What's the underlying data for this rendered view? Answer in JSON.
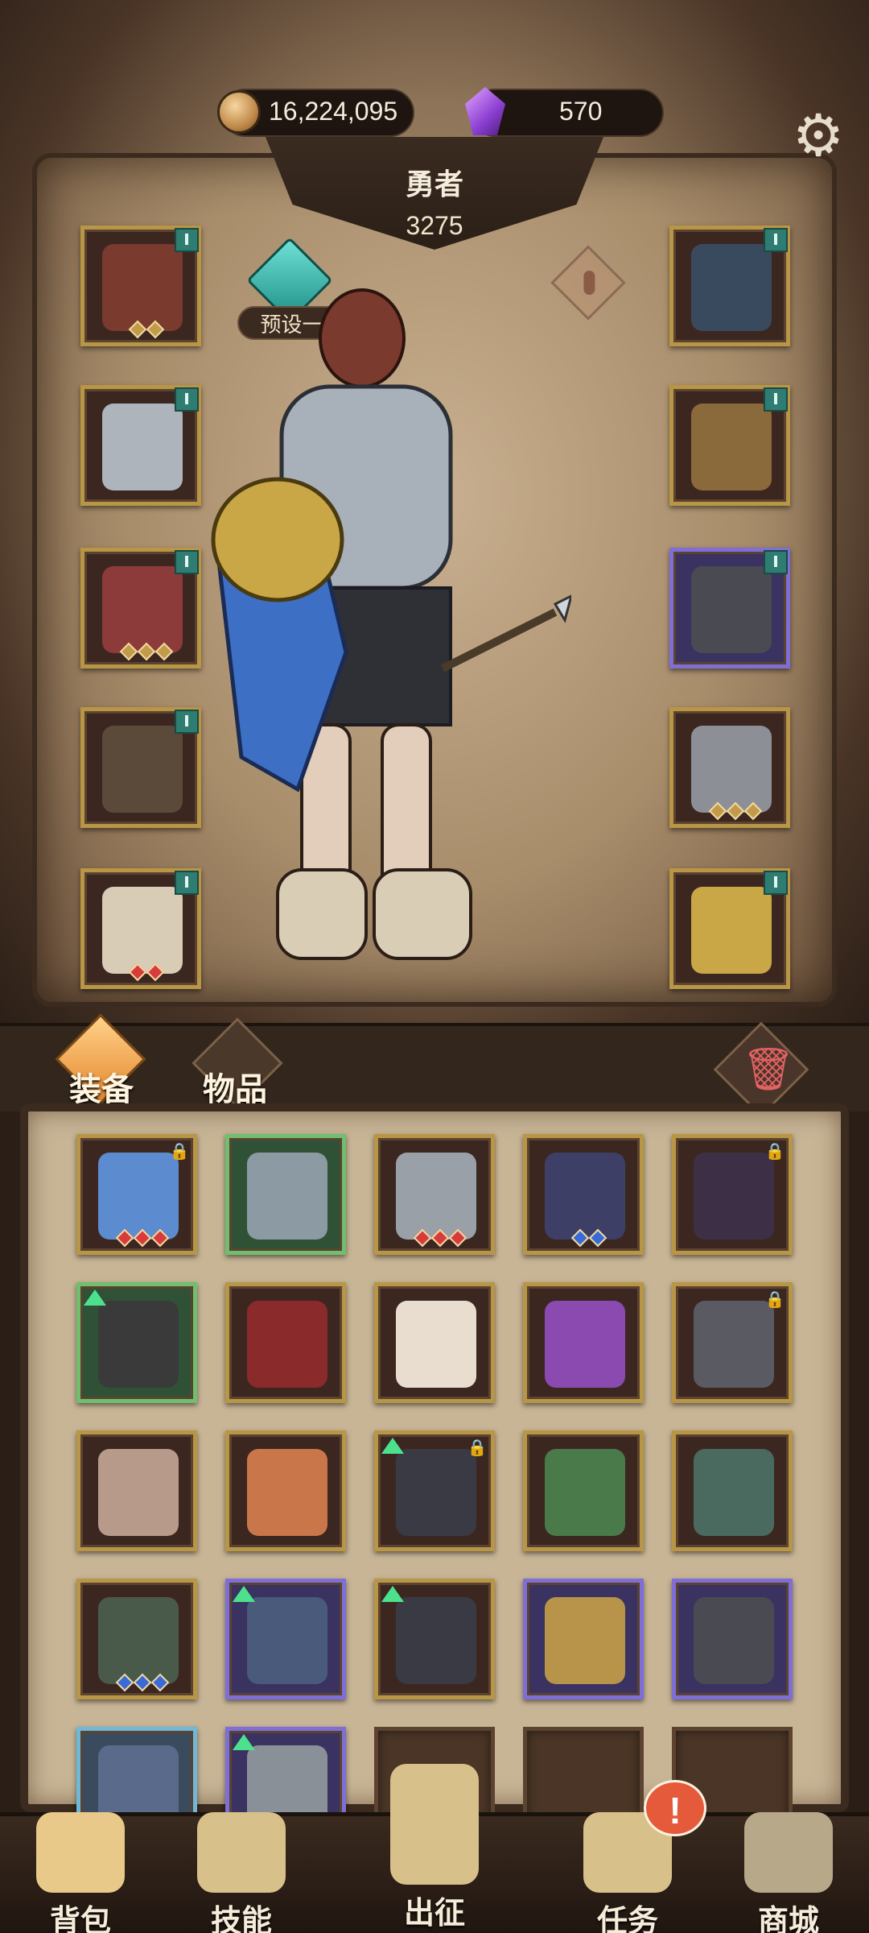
{
  "currency": {
    "gold": "16,224,095",
    "gems": "570"
  },
  "hero": {
    "name": "勇者",
    "power": "3275",
    "preset_label": "预设一"
  },
  "equipment_slots": {
    "left": [
      "head-icon",
      "chest-armor-icon",
      "gauntlet-icon",
      "belt-icon",
      "boots-icon"
    ],
    "right": [
      "amulet-icon",
      "ring-red-icon",
      "ring-iron-icon",
      "spear-icon",
      "lion-shield-icon"
    ]
  },
  "tabs": {
    "equip_label": "装备",
    "items_label": "物品"
  },
  "inventory": [
    [
      "ice-sword-icon",
      "gem-ring-icon",
      "rapier-icon",
      "shadow-armor-icon",
      "dark-blade-icon"
    ],
    [
      "leather-boots-icon",
      "red-armor-icon",
      "torch-icon",
      "purple-spear-icon",
      "chain-helm-icon"
    ],
    [
      "bone-axe-icon",
      "plate-armor-icon",
      "greaves-icon",
      "potion-amulet-icon",
      "thorn-spear-icon"
    ],
    [
      "wing-armor-icon",
      "arm-guard-icon",
      "iron-greaves-icon",
      "gold-ring-icon",
      "iron-ring-icon"
    ],
    [
      "winged-leggings-icon",
      "knight-helm-icon",
      "empty",
      "empty",
      "empty"
    ]
  ],
  "nav": {
    "bag_label": "背包",
    "skill_label": "技能",
    "go_label": "出征",
    "task_label": "任务",
    "shop_label": "商城",
    "notify_mark": "!"
  },
  "colors": {
    "frame_gold": "#b89646",
    "rarity_purple": "#7e6fd8",
    "rarity_green": "#6fbf6e",
    "rarity_blue": "#6fb8d8",
    "upgrade_arrow": "#4de18e",
    "badge_teal": "#2f7d72"
  }
}
